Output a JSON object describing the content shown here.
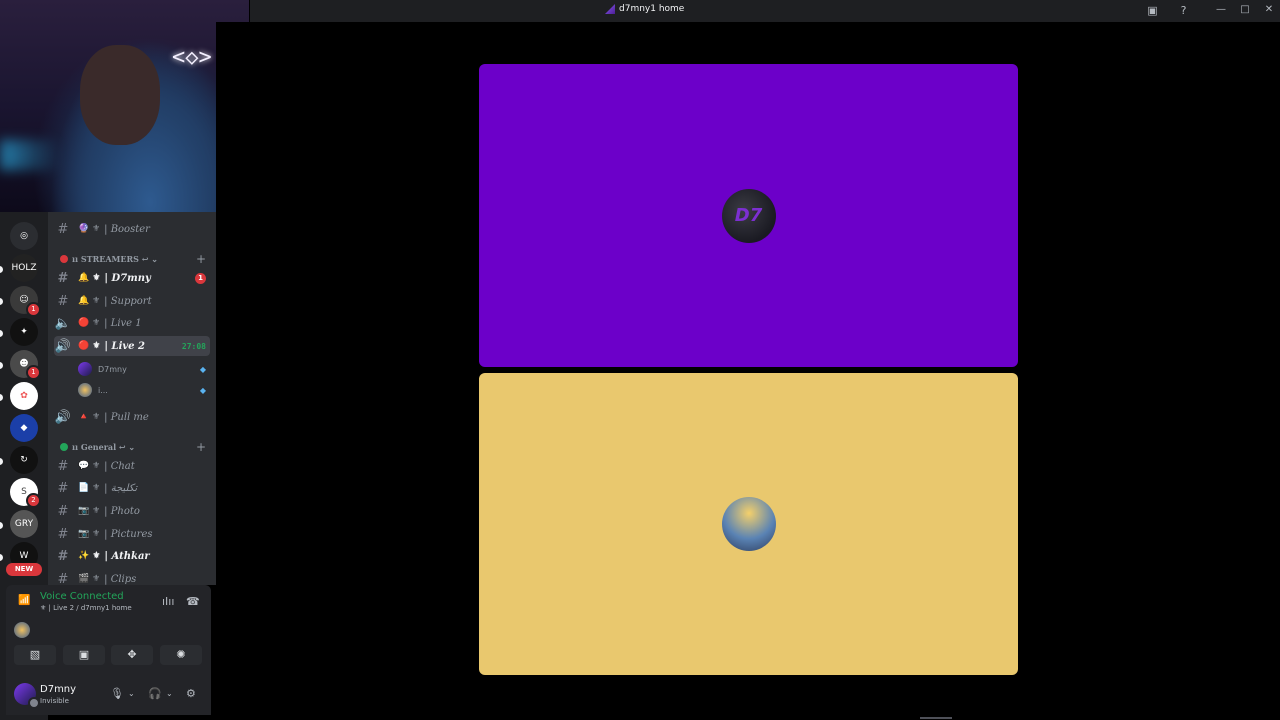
{
  "window": {
    "title": "d7mny1 home"
  },
  "webcam": {
    "neon_sign": "<◇>"
  },
  "guilds": {
    "badges": [
      "1",
      "1",
      "2"
    ],
    "new_label": "NEW"
  },
  "channels": {
    "top_item": {
      "emoji": "🔮 ⚜",
      "label": "| Booster"
    },
    "streamers_category": "ıı STREAMERS ↩ ⌄",
    "streamers": [
      {
        "emoji": "🔔 ⚜",
        "label": "| D7mny",
        "unread": "1"
      },
      {
        "emoji": "🔔 ⚜",
        "label": "| Support"
      },
      {
        "emoji": "🔴 ⚜",
        "label": "| Live 1"
      },
      {
        "emoji": "🔴 ⚜",
        "label": "| Live 2",
        "timer": "27:08"
      }
    ],
    "voice_users": [
      {
        "name": "D7mny"
      },
      {
        "name": "i..."
      }
    ],
    "pull_me": {
      "emoji": "🔺 ⚜",
      "label": "| Pull me"
    },
    "general_category": "ıı General ↩ ⌄",
    "general": [
      {
        "emoji": "💬 ⚜",
        "label": "| Chat"
      },
      {
        "emoji": "📄 ⚜",
        "label": "| تكليجة"
      },
      {
        "emoji": "📷 ⚜",
        "label": "| Photo"
      },
      {
        "emoji": "📷 ⚜",
        "label": "| Pictures"
      },
      {
        "emoji": "✨ ⚜",
        "label": "| Athkar"
      },
      {
        "emoji": "🎬 ⚜",
        "label": "| Clips"
      }
    ]
  },
  "voice_panel": {
    "status": "Voice Connected",
    "channel": "⚜ | Live 2 / d7mny1 home"
  },
  "user_panel": {
    "name": "D7mny",
    "status": "Invisible"
  },
  "stage": {
    "top_tile_color": "#6c00c9",
    "bottom_tile_color": "#e9c86e",
    "top_avatar_text": "D7"
  },
  "colors": {
    "connected_green": "#23a55a",
    "badge_red": "#da373c"
  }
}
